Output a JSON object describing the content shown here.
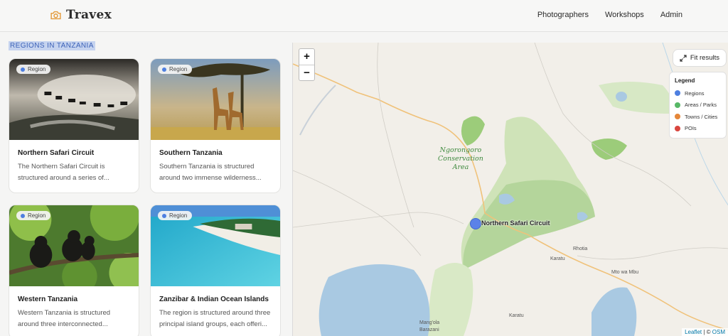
{
  "app": {
    "brand": "Travex"
  },
  "nav": {
    "items": [
      "Photographers",
      "Workshops",
      "Admin"
    ]
  },
  "left": {
    "section_title": "REGIONS IN TANZANIA",
    "cards": [
      {
        "tag": "Region",
        "title": "Northern Safari Circuit",
        "desc": "The Northern Safari Circuit is structured around a series of..."
      },
      {
        "tag": "Region",
        "title": "Southern Tanzania",
        "desc": "Southern Tanzania is structured around two immense wilderness..."
      },
      {
        "tag": "Region",
        "title": "Western Tanzania",
        "desc": "Western Tanzania is structured around three interconnected..."
      },
      {
        "tag": "Region",
        "title": "Zanzibar & Indian Ocean Islands",
        "desc": "The region is structured around three principal island groups, each offeri..."
      }
    ]
  },
  "map": {
    "zoom_in": "+",
    "zoom_out": "−",
    "fit_label": "Fit results",
    "legend": {
      "title": "Legend",
      "items": [
        {
          "label": "Regions",
          "color": "#4e7fe0"
        },
        {
          "label": "Areas / Parks",
          "color": "#58b867"
        },
        {
          "label": "Towns / Cities",
          "color": "#e5873a"
        },
        {
          "label": "POIs",
          "color": "#d9463f"
        }
      ]
    },
    "marker_label": "Northern Safari Circuit",
    "area_label_line1": "Ngorongoro",
    "area_label_line2": "Conservation",
    "area_label_line3": "Area",
    "places": [
      "Rhotia",
      "Karatu",
      "Mto wa Mbu",
      "Karatu",
      "Mang'ola",
      "Barazani"
    ],
    "attribution_link": "Leaflet",
    "attribution_sep": " | © ",
    "attribution_osm": "OSM"
  }
}
